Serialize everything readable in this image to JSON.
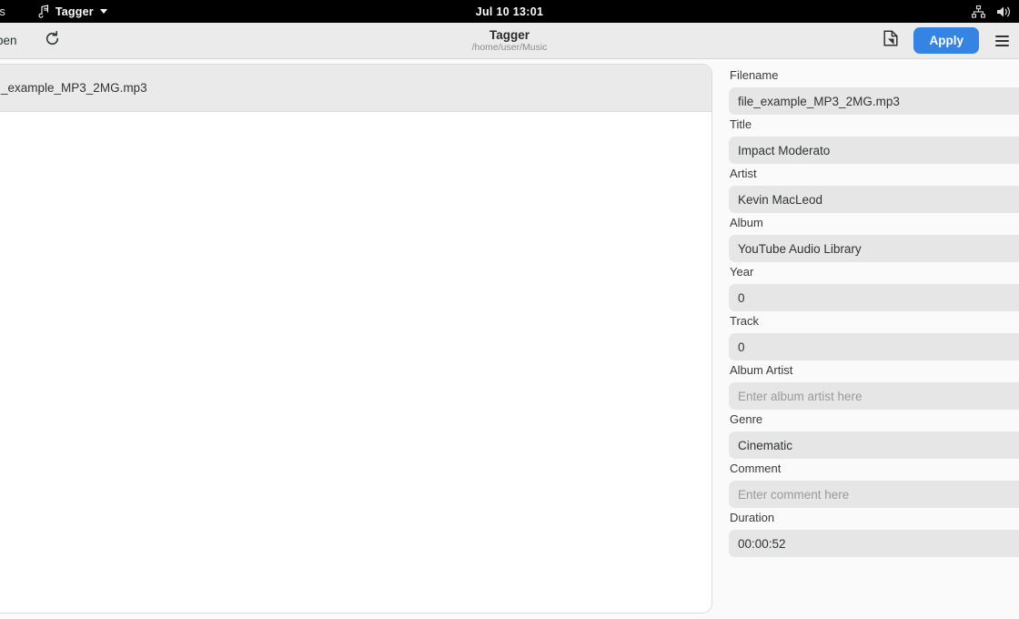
{
  "topbar": {
    "activities_label": "ties",
    "app_name": "Tagger",
    "app_icon": "music-note-icon",
    "clock": "Jul 10  13:01",
    "network_icon": "network-sitemap-icon",
    "volume_icon": "volume-speaker-icon"
  },
  "headerbar": {
    "open_label": "pen",
    "refresh_icon": "refresh-icon",
    "title": "Tagger",
    "subtitle": "/home/user/Music",
    "tag_icon": "file-tag-icon",
    "apply_label": "Apply",
    "menu_icon": "hamburger-menu-icon"
  },
  "file_list": {
    "items": [
      {
        "label": "_example_MP3_2MG.mp3",
        "selected": true
      }
    ]
  },
  "properties": {
    "fields": [
      {
        "label": "Filename",
        "value": "file_example_MP3_2MG.mp3",
        "placeholder": "",
        "is_placeholder": false
      },
      {
        "label": "Title",
        "value": "Impact Moderato",
        "placeholder": "",
        "is_placeholder": false
      },
      {
        "label": "Artist",
        "value": "Kevin MacLeod",
        "placeholder": "",
        "is_placeholder": false
      },
      {
        "label": "Album",
        "value": "YouTube Audio Library",
        "placeholder": "",
        "is_placeholder": false
      },
      {
        "label": "Year",
        "value": "0",
        "placeholder": "",
        "is_placeholder": false
      },
      {
        "label": "Track",
        "value": "0",
        "placeholder": "",
        "is_placeholder": false
      },
      {
        "label": "Album Artist",
        "value": "Enter album artist here",
        "placeholder": "Enter album artist here",
        "is_placeholder": true
      },
      {
        "label": "Genre",
        "value": "Cinematic",
        "placeholder": "",
        "is_placeholder": false
      },
      {
        "label": "Comment",
        "value": "Enter comment here",
        "placeholder": "Enter comment here",
        "is_placeholder": true
      },
      {
        "label": "Duration",
        "value": "00:00:52",
        "placeholder": "",
        "is_placeholder": false
      }
    ]
  },
  "colors": {
    "accent": "#3584e4",
    "topbar_bg": "#000000",
    "header_bg": "#ebebeb",
    "content_bg": "#fafafa",
    "input_bg": "#e6e6e6",
    "row_selected_bg": "#eaeaea"
  }
}
